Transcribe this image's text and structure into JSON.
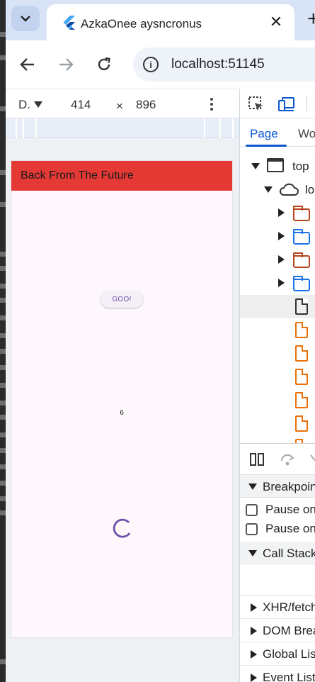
{
  "browser": {
    "tab_title": "AzkaOnee aysncronus",
    "url": "localhost:51145"
  },
  "device_toolbar": {
    "device": "D.",
    "width": "414",
    "times": "×",
    "height": "896"
  },
  "app": {
    "appbar_title": "Back From The Future",
    "button_label": "GOO!",
    "counter": "6",
    "appbar_color": "#e53935",
    "background_color": "#fef7fb",
    "accent_color": "#6b4fa8"
  },
  "devtools": {
    "tabs": {
      "page": "Page",
      "workspace": "Wo"
    },
    "tree": {
      "top": "top",
      "origin": "lo"
    },
    "debugger": {
      "breakpoints": "Breakpoin",
      "pause_1": "Pause on",
      "pause_2": "Pause on",
      "call_stack": "Call Stack",
      "xhr": "XHR/fetch",
      "dom": "DOM Brea",
      "global": "Global Lis",
      "event": "Event List"
    }
  }
}
